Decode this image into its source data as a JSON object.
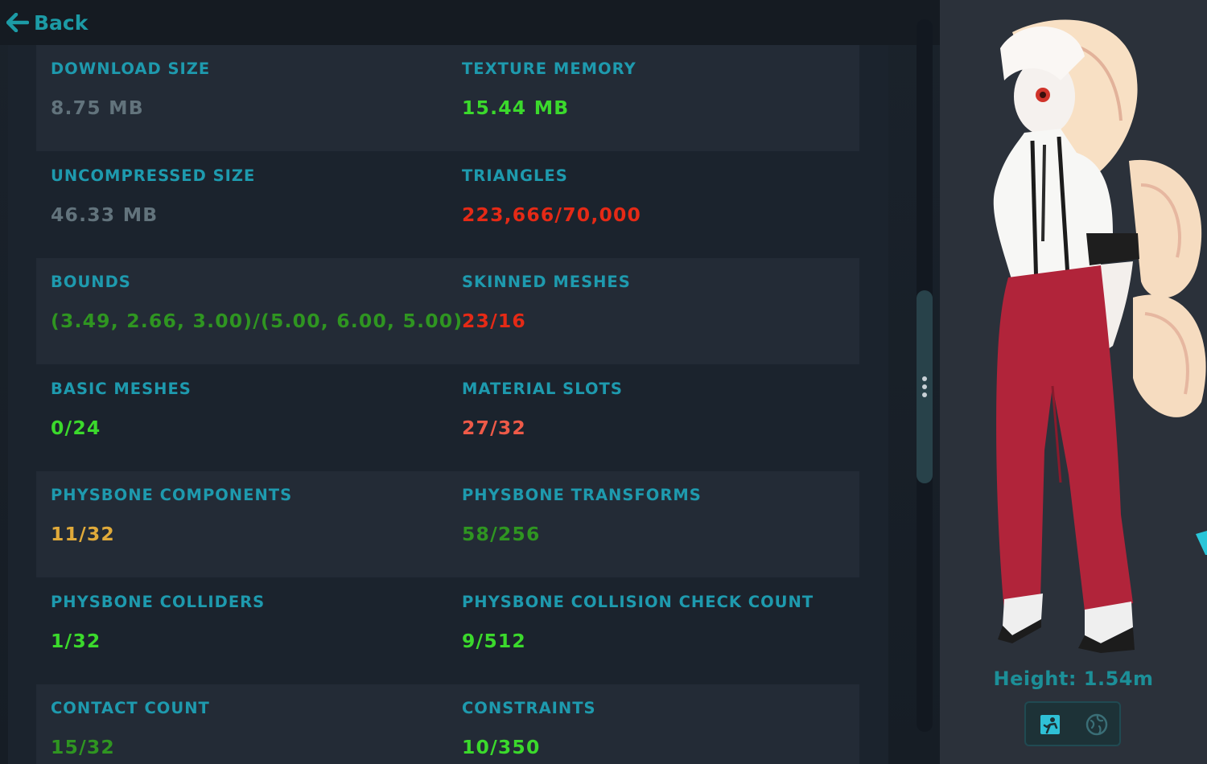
{
  "nav": {
    "back_label": "Back"
  },
  "stats": [
    [
      {
        "label": "DOWNLOAD SIZE",
        "value": "8.75 MB",
        "color": "#62737c"
      },
      {
        "label": "TEXTURE MEMORY",
        "value": "15.44 MB",
        "color": "#3bd92c"
      }
    ],
    [
      {
        "label": "UNCOMPRESSED SIZE",
        "value": "46.33 MB",
        "color": "#62737c"
      },
      {
        "label": "TRIANGLES",
        "value": "223,666/70,000",
        "color": "#e52a16"
      }
    ],
    [
      {
        "label": "BOUNDS",
        "value": "(3.49, 2.66, 3.00)/(5.00, 6.00, 5.00)",
        "color": "#2f9521"
      },
      {
        "label": "SKINNED MESHES",
        "value": "23/16",
        "color": "#e52a16"
      }
    ],
    [
      {
        "label": "BASIC MESHES",
        "value": "0/24",
        "color": "#3bd92c"
      },
      {
        "label": "MATERIAL SLOTS",
        "value": "27/32",
        "color": "#ee5a48"
      }
    ],
    [
      {
        "label": "PHYSBONE COMPONENTS",
        "value": "11/32",
        "color": "#e0aa3a"
      },
      {
        "label": "PHYSBONE TRANSFORMS",
        "value": "58/256",
        "color": "#2f9521"
      }
    ],
    [
      {
        "label": "PHYSBONE COLLIDERS",
        "value": "1/32",
        "color": "#3bd92c"
      },
      {
        "label": "PHYSBONE COLLISION CHECK COUNT",
        "value": "9/512",
        "color": "#3bd92c"
      }
    ],
    [
      {
        "label": "CONTACT COUNT",
        "value": "15/32",
        "color": "#2f9521"
      },
      {
        "label": "CONSTRAINTS",
        "value": "10/350",
        "color": "#3bd92c"
      }
    ]
  ],
  "preview": {
    "height_label": "Height: 1.54m",
    "view_buttons": [
      {
        "icon": "avatar-pose-icon",
        "active": true
      },
      {
        "icon": "globe-icon",
        "active": false
      }
    ]
  },
  "colors": {
    "label": "#1e9aae",
    "accent": "#1c9ba6",
    "panel": "#1b232d",
    "row_shade": "#232b36"
  }
}
